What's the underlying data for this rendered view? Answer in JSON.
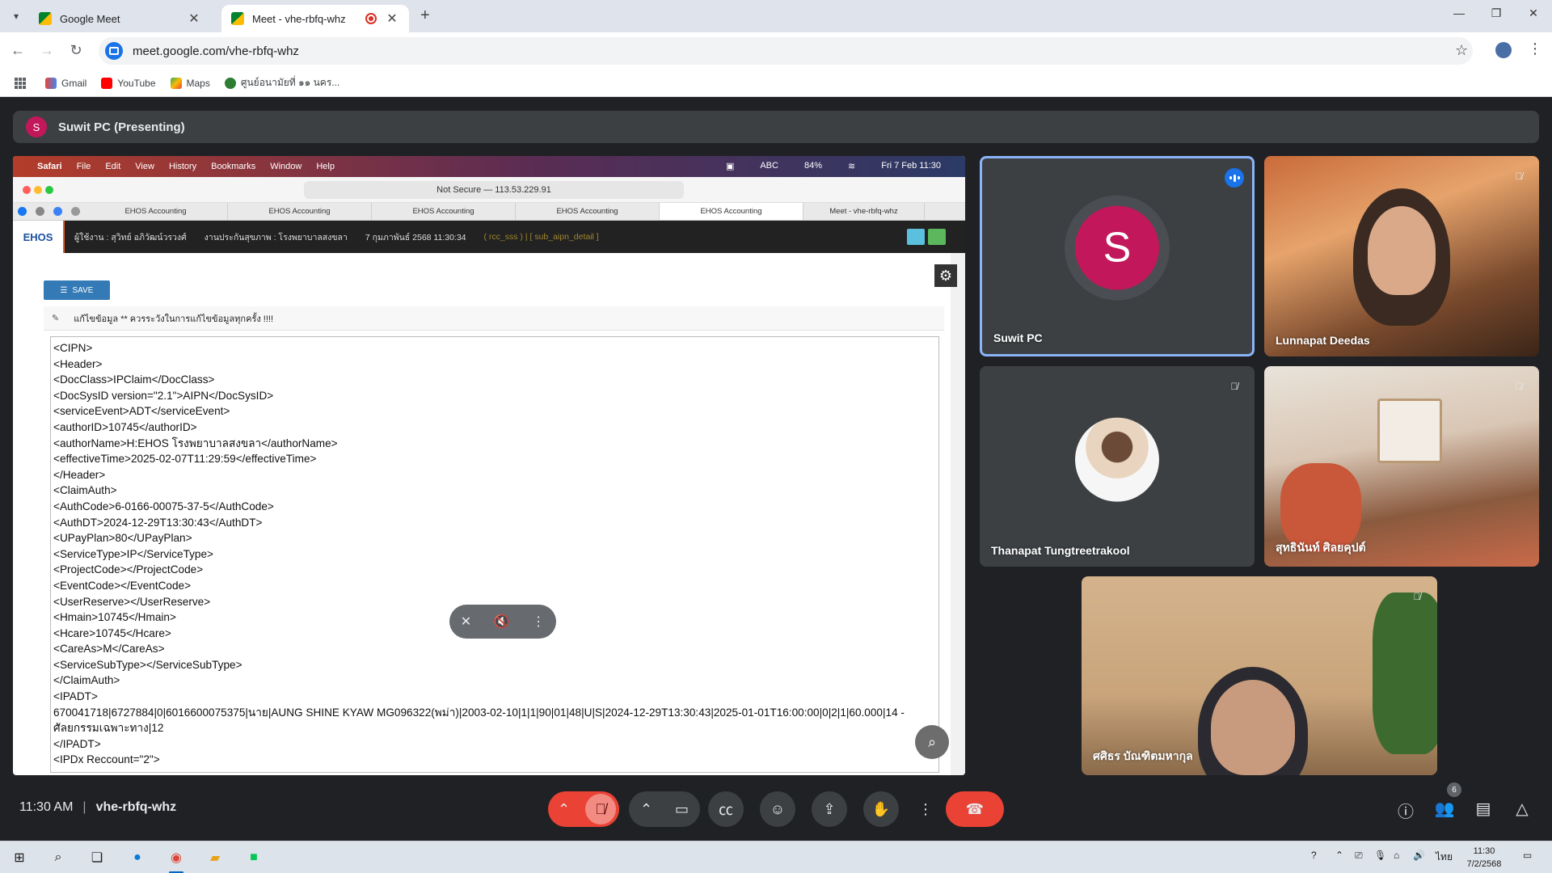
{
  "browser": {
    "tabs": [
      {
        "title": "Google Meet",
        "active": false
      },
      {
        "title": "Meet - vhe-rbfq-whz",
        "active": true
      }
    ],
    "url": "meet.google.com/vhe-rbfq-whz",
    "bookmarks": [
      "Gmail",
      "YouTube",
      "Maps",
      "ศูนย์อนามัยที่ ๑๑ นคร..."
    ]
  },
  "presenting": {
    "avatar_letter": "S",
    "title": "Suwit PC (Presenting)"
  },
  "shared_screen": {
    "mac_menu": [
      "Safari",
      "File",
      "Edit",
      "View",
      "History",
      "Bookmarks",
      "Window",
      "Help"
    ],
    "mac_status": {
      "battery": "84%",
      "datetime": "Fri 7 Feb 11:30",
      "input": "ABC"
    },
    "safari_address": "Not Secure — 113.53.229.91",
    "safari_tabs": [
      "EHOS Accounting",
      "EHOS Accounting",
      "EHOS Accounting",
      "EHOS Accounting",
      "EHOS Accounting",
      "Meet - vhe-rbfq-whz"
    ],
    "app_header": {
      "logo": "EHOS",
      "user": "ผู้ใช้งาน : สุวิทย์ อภิวัฒน์วรวงศ์",
      "unit": "งานประกันสุขภาพ : โรงพยาบาลสงขลา",
      "datetime": "7 กุมภาพันธ์ 2568 11:30:34",
      "module": "( rcc_sss ) | [ sub_aipn_detail ]"
    },
    "save_label": "SAVE",
    "edit_notice": "แก้ไขข้อมูล ** ควรระวังในการแก้ไขข้อมูลทุกครั้ง !!!!",
    "xml_lines": [
      "<CIPN>",
      "<Header>",
      "<DocClass>IPClaim</DocClass>",
      "<DocSysID version=\"2.1\">AIPN</DocSysID>",
      "<serviceEvent>ADT</serviceEvent>",
      "<authorID>10745</authorID>",
      "<authorName>H:EHOS โรงพยาบาลสงขลา</authorName>",
      "<effectiveTime>2025-02-07T11:29:59</effectiveTime>",
      "</Header>",
      "<ClaimAuth>",
      "<AuthCode>6-0166-00075-37-5</AuthCode>",
      "<AuthDT>2024-12-29T13:30:43</AuthDT>",
      "<UPayPlan>80</UPayPlan>",
      "<ServiceType>IP</ServiceType>",
      "<ProjectCode></ProjectCode>",
      "<EventCode></EventCode>",
      "<UserReserve></UserReserve>",
      "<Hmain>10745</Hmain>",
      "<Hcare>10745</Hcare>",
      "<CareAs>M</CareAs>",
      "<ServiceSubType></ServiceSubType>",
      "</ClaimAuth>",
      "<IPADT>",
      "670041718|6727884|0|6016600075375|นาย|AUNG SHINE KYAW MG096322(พม่า)|2003-02-10|1|1|90|01|48|U|S|2024-12-29T13:30:43|2025-01-01T16:00:00|0|2|1|60.000|14 - ศัลยกรรมเฉพาะทาง|12",
      "</IPADT>",
      "<IPDx Reccount=\"2\">"
    ]
  },
  "participants": [
    {
      "name": "Suwit PC",
      "avatar_letter": "S",
      "speaking": true
    },
    {
      "name": "Lunnapat Deedas",
      "muted": true
    },
    {
      "name": "Thanapat Tungtreetrakool",
      "muted": true
    },
    {
      "name": "สุทธินันท์ ศิลยคุปต์",
      "muted": true
    },
    {
      "name": "ศศิธร บัณฑิตมหากุล",
      "muted": true
    }
  ],
  "bottom": {
    "time": "11:30 AM",
    "meeting_code": "vhe-rbfq-whz",
    "participant_count": "6"
  },
  "taskbar": {
    "lang": "ไทย",
    "time": "11:30",
    "date": "7/2/2568"
  },
  "colors": {
    "meet_bg": "#202124",
    "tile_bg": "#3c4043",
    "end_call": "#ea4335",
    "active_outline": "#8ab4f8",
    "presenter_avatar": "#c2185b"
  }
}
